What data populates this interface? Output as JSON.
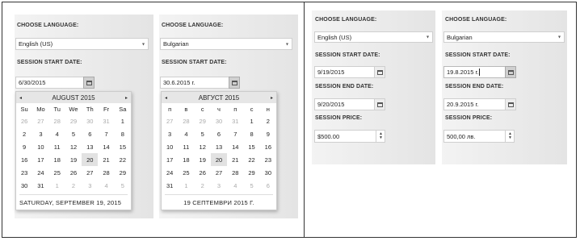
{
  "left": {
    "en": {
      "choose_language": "CHOOSE LANGUAGE:",
      "language_value": "English (US)",
      "session_start": "SESSION START DATE:",
      "start_value": "6/30/2015",
      "calendar": {
        "month": "AUGUST 2015",
        "prev": "◂",
        "next": "▸",
        "dow": [
          "Su",
          "Mo",
          "Tu",
          "We",
          "Th",
          "Fr",
          "Sa"
        ],
        "weeks": [
          [
            "26",
            "27",
            "28",
            "29",
            "30",
            "31",
            "1"
          ],
          [
            "2",
            "3",
            "4",
            "5",
            "6",
            "7",
            "8"
          ],
          [
            "9",
            "10",
            "11",
            "12",
            "13",
            "14",
            "15"
          ],
          [
            "16",
            "17",
            "18",
            "19",
            "20",
            "21",
            "22"
          ],
          [
            "23",
            "24",
            "25",
            "26",
            "27",
            "28",
            "29"
          ],
          [
            "30",
            "31",
            "1",
            "2",
            "3",
            "4",
            "5"
          ]
        ],
        "footer": "SATURDAY, SEPTEMBER 19, 2015"
      }
    },
    "bg": {
      "choose_language": "CHOOSE LANGUAGE:",
      "language_value": "Bulgarian",
      "session_start": "SESSION START DATE:",
      "start_value": "30.6.2015 г.",
      "calendar": {
        "month": "АВГУСТ 2015",
        "prev": "◂",
        "next": "▸",
        "dow": [
          "п",
          "в",
          "с",
          "ч",
          "п",
          "с",
          "н"
        ],
        "weeks": [
          [
            "27",
            "28",
            "29",
            "30",
            "31",
            "1",
            "2"
          ],
          [
            "3",
            "4",
            "5",
            "6",
            "7",
            "8",
            "9"
          ],
          [
            "10",
            "11",
            "12",
            "13",
            "14",
            "15",
            "16"
          ],
          [
            "17",
            "18",
            "19",
            "20",
            "21",
            "22",
            "23"
          ],
          [
            "24",
            "25",
            "26",
            "27",
            "28",
            "29",
            "30"
          ],
          [
            "31",
            "1",
            "2",
            "3",
            "4",
            "5",
            "6"
          ]
        ],
        "footer": "19 СЕПТЕМВРИ 2015 Г."
      }
    }
  },
  "right": {
    "en": {
      "choose_language": "CHOOSE LANGUAGE:",
      "language_value": "English (US)",
      "session_start": "SESSION START DATE:",
      "start_value": "9/19/2015",
      "session_end": "SESSION END DATE:",
      "end_value": "9/20/2015",
      "session_price": "SESSION PRICE:",
      "price_value": "$500.00"
    },
    "bg": {
      "choose_language": "CHOOSE LANGUAGE:",
      "language_value": "Bulgarian",
      "session_start": "SESSION START DATE:",
      "start_value": "19.8.2015 г.",
      "session_end": "SESSION END DATE:",
      "end_value": "20.9.2015 г.",
      "session_price": "SESSION PRICE:",
      "price_value": "500,00 лв."
    }
  },
  "icons": {
    "caret": "▾",
    "calendar": "calendar-icon",
    "stepper_up": "▲",
    "stepper_down": "▼"
  }
}
